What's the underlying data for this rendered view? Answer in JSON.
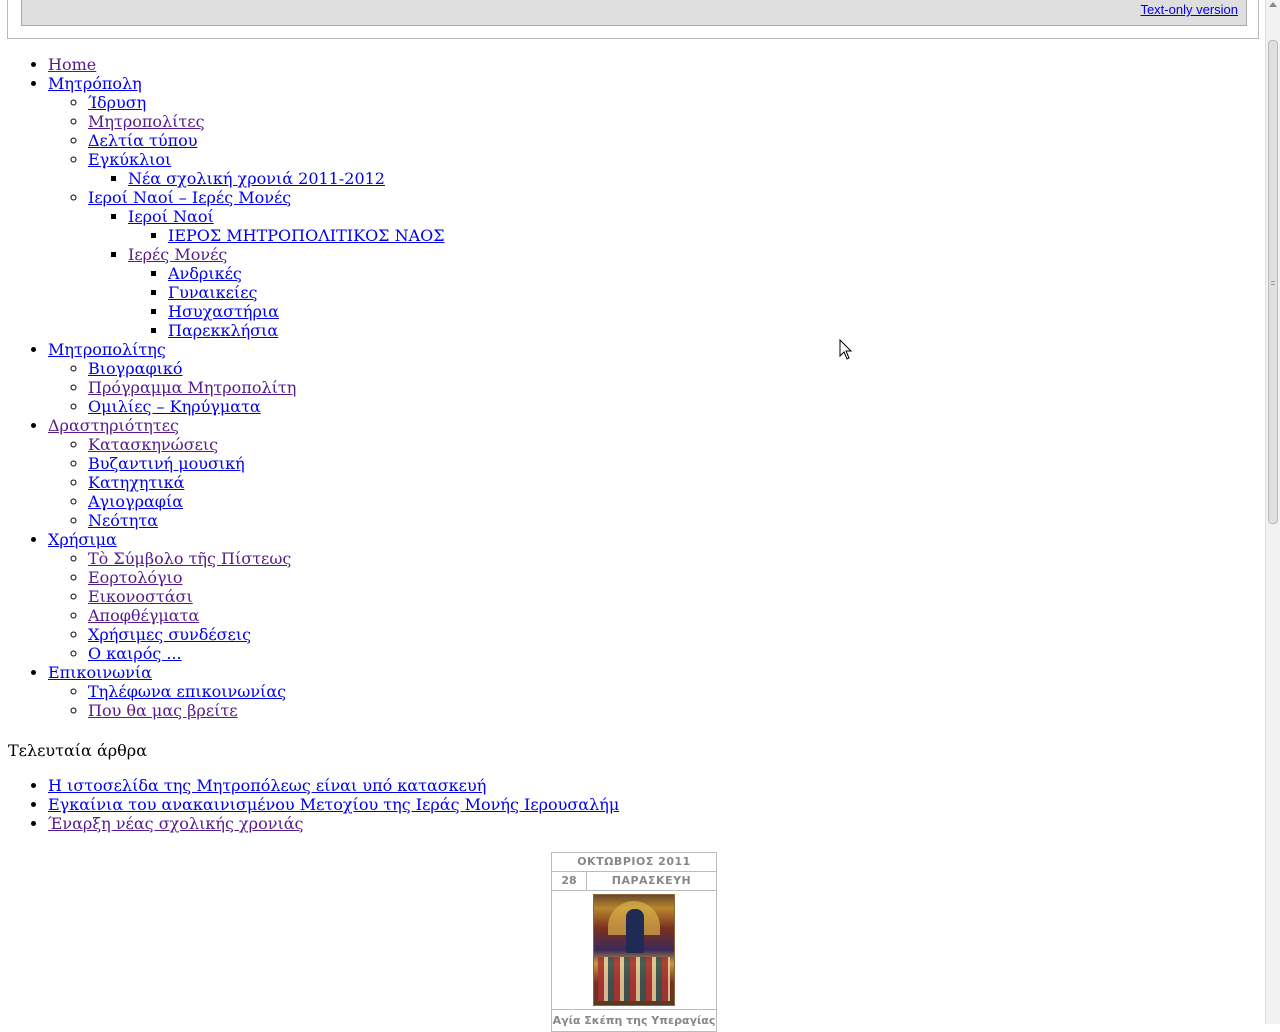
{
  "header": {
    "text_only_link": "Text-only version"
  },
  "menu": {
    "home": "Home",
    "mitropoli": {
      "label": "Μητρόπολη",
      "items": {
        "idrysi": "Ίδρυση",
        "mitropolites": "Μητροπολίτες",
        "deltia": "Δελτία τύπου",
        "egkyklioi": "Εγκύκλιοι",
        "nea_xroniа": "Νέα σχολική χρονιά 2011-2012",
        "naoi_mones": "Ιεροί Ναοί – Ιερές Μονές",
        "ieroi_naoi": "Ιεροί Ναοί",
        "mitropolitikos": "ΙΕΡΟΣ ΜΗΤΡΟΠΟΛΙΤΙΚΟΣ ΝΑΟΣ",
        "ieres_mones": "Ιερές Μονές",
        "andrikes": "Ανδρικές",
        "gynaikeies": "Γυναικείες",
        "isyxastiria": "Ησυχαστήρια",
        "parekklisia": "Παρεκκλήσια"
      }
    },
    "mitropolitis": {
      "label": "Μητροπολίτης",
      "items": {
        "viografiko": "Βιογραφικό",
        "programma": "Πρόγραμμα Μητροπολίτη",
        "omilies": "Ομιλίες – Κηρύγματα"
      }
    },
    "drastiriotites": {
      "label": "Δραστηριότητες",
      "items": {
        "kataskinoseis": "Κατασκηνώσεις",
        "vyzantini": "Βυζαντινή μουσική",
        "katixitika": "Κατηχητικά",
        "agiografia": "Αγιογραφία",
        "neotita": "Νεότητα"
      }
    },
    "xrisima": {
      "label": "Χρήσιμα",
      "items": {
        "symvolo": "Τὸ Σύμβολο τῆς Πίστεως",
        "eortologio": "Εορτολόγιο",
        "eikonostasi": "Εικονοστάσι",
        "apofthegmata": "Αποφθέγματα",
        "syndeseis": "Χρήσιμες συνδέσεις",
        "kairos": "Ο καιρός ..."
      }
    },
    "epikoinonia": {
      "label": "Επικοινωνία",
      "items": {
        "tilefona": "Τηλέφωνα επικοινωνίας",
        "pou": "Που θα μας βρείτε"
      }
    }
  },
  "recent": {
    "title": "Τελευταία άρθρα",
    "items": {
      "a1": "Η ιστοσελίδα της Μητροπόλεως είναι υπό κατασκευή",
      "a2": "Εγκαίνια του ανακαινισμένου Μετοχίου της Ιεράς Μονής Ιερουσαλήμ",
      "a3": "Έναρξη νέας σχολικής χρονιάς"
    }
  },
  "calendar": {
    "month_year": "ΟΚΤΩΒΡΙΟΣ 2011",
    "day": "28",
    "weekday": "ΠΑΡΑΣΚΕΥΗ",
    "feast": "Αγία Σκέπη της Υπεραγίας",
    "icon": "icon-image"
  },
  "colors": {
    "link": "#0000ee",
    "visited": "#551a8b",
    "header_bar": "#dedede"
  }
}
